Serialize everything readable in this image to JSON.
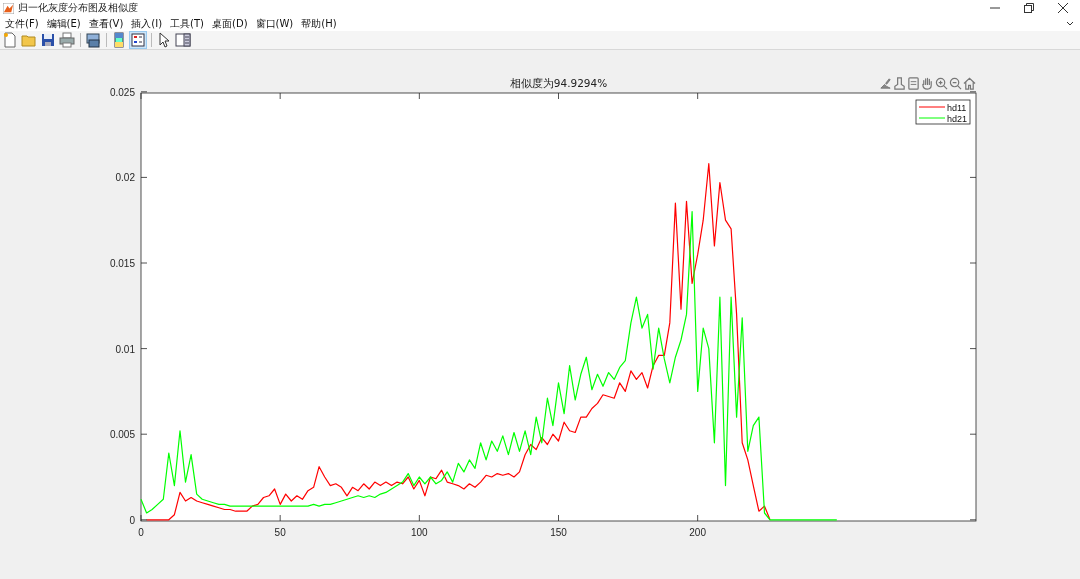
{
  "window": {
    "title": "归一化灰度分布图及相似度"
  },
  "menu": [
    "文件(F)",
    "编辑(E)",
    "查看(V)",
    "插入(I)",
    "工具(T)",
    "桌面(D)",
    "窗口(W)",
    "帮助(H)"
  ],
  "toolbar": [
    {
      "kind": "new",
      "selected": false
    },
    {
      "kind": "open",
      "selected": false
    },
    {
      "kind": "save",
      "selected": false
    },
    {
      "kind": "print",
      "selected": false
    },
    {
      "kind": "link",
      "selected": false
    },
    {
      "kind": "colorbar",
      "selected": false
    },
    {
      "kind": "legend",
      "selected": true
    },
    {
      "kind": "pointer",
      "selected": false
    },
    {
      "kind": "panel",
      "selected": false
    }
  ],
  "axes": {
    "title": "相似度为94.9294%",
    "chart_data": {
      "type": "line",
      "xlim": [
        0,
        300
      ],
      "ylim": [
        0,
        0.025
      ],
      "xticks": [
        0,
        50,
        100,
        150,
        200
      ],
      "yticks": [
        0,
        0.005,
        0.01,
        0.015,
        0.02,
        0.025
      ],
      "legend": "upper right",
      "x": [
        0,
        2,
        4,
        6,
        8,
        10,
        12,
        14,
        16,
        18,
        20,
        22,
        24,
        26,
        28,
        30,
        32,
        34,
        36,
        38,
        40,
        42,
        44,
        46,
        48,
        50,
        52,
        54,
        56,
        58,
        60,
        62,
        64,
        66,
        68,
        70,
        72,
        74,
        76,
        78,
        80,
        82,
        84,
        86,
        88,
        90,
        92,
        94,
        96,
        98,
        100,
        102,
        104,
        106,
        108,
        110,
        112,
        114,
        116,
        118,
        120,
        122,
        124,
        126,
        128,
        130,
        132,
        134,
        136,
        138,
        140,
        142,
        144,
        146,
        148,
        150,
        152,
        154,
        156,
        158,
        160,
        162,
        164,
        166,
        168,
        170,
        172,
        174,
        176,
        178,
        180,
        182,
        184,
        186,
        188,
        190,
        192,
        194,
        196,
        198,
        200,
        202,
        204,
        206,
        208,
        210,
        212,
        214,
        216,
        218,
        220,
        222,
        224,
        226,
        228,
        230,
        232,
        234,
        236,
        238,
        240,
        242,
        244,
        246,
        248,
        250
      ],
      "series": [
        {
          "name": "hd11",
          "color": "#ff0000",
          "values": [
            null,
            0,
            0,
            0,
            0,
            0,
            0.0003,
            0.0016,
            0.0011,
            0.0013,
            0.0011,
            0.001,
            0.0009,
            0.0008,
            0.0007,
            0.0006,
            0.0006,
            0.0005,
            0.0005,
            0.0005,
            0.0008,
            0.0009,
            0.0013,
            0.0014,
            0.0018,
            0.0009,
            0.0015,
            0.0011,
            0.0014,
            0.0012,
            0.0017,
            0.0019,
            0.0031,
            0.0025,
            0.002,
            0.0021,
            0.0019,
            0.0014,
            0.0019,
            0.0017,
            0.0021,
            0.0018,
            0.0022,
            0.002,
            0.0022,
            0.002,
            0.0022,
            0.0021,
            0.0025,
            0.0018,
            0.0023,
            0.0014,
            0.0025,
            0.0024,
            0.0029,
            0.0022,
            0.0021,
            0.002,
            0.0018,
            0.0021,
            0.0019,
            0.0022,
            0.0026,
            0.0025,
            0.0027,
            0.0026,
            0.0027,
            0.0025,
            0.0028,
            0.0038,
            0.0044,
            0.0041,
            0.0048,
            0.0044,
            0.005,
            0.0046,
            0.0057,
            0.0052,
            0.0051,
            0.006,
            0.006,
            0.0065,
            0.0068,
            0.0073,
            0.0072,
            0.0071,
            0.008,
            0.0075,
            0.0087,
            0.0082,
            0.0086,
            0.0077,
            0.009,
            0.0096,
            0.0096,
            0.0115,
            0.0185,
            0.0123,
            0.0186,
            0.0138,
            0.0155,
            0.0175,
            0.0208,
            0.016,
            0.0197,
            0.0175,
            0.017,
            0.012,
            0.0045,
            0.0035,
            0.002,
            0.0005,
            0.0008,
            0,
            null,
            null,
            null,
            null,
            null,
            null,
            null,
            null,
            null,
            null,
            null,
            null
          ]
        },
        {
          "name": "hd21",
          "color": "#00ff00",
          "values": [
            0.0012,
            0.0004,
            0.0006,
            0.0009,
            0.0012,
            0.0039,
            0.002,
            0.0052,
            0.0022,
            0.0038,
            0.0015,
            0.0012,
            0.0011,
            0.001,
            0.0009,
            0.0009,
            0.0008,
            0.0008,
            0.0008,
            0.0008,
            0.0008,
            0.0008,
            0.0008,
            0.0008,
            0.0008,
            0.0008,
            0.0008,
            0.0008,
            0.0008,
            0.0008,
            0.0008,
            0.0009,
            0.0008,
            0.0009,
            0.0009,
            0.001,
            0.0011,
            0.0012,
            0.0013,
            0.0014,
            0.0013,
            0.0014,
            0.0013,
            0.0015,
            0.0016,
            0.0018,
            0.002,
            0.0022,
            0.0027,
            0.002,
            0.0025,
            0.0021,
            0.0025,
            0.0021,
            0.0023,
            0.0028,
            0.0022,
            0.0033,
            0.0028,
            0.0035,
            0.003,
            0.0045,
            0.0035,
            0.0046,
            0.004,
            0.0049,
            0.0038,
            0.0051,
            0.004,
            0.0052,
            0.0038,
            0.006,
            0.0045,
            0.0071,
            0.0055,
            0.008,
            0.0062,
            0.009,
            0.007,
            0.0085,
            0.0095,
            0.0076,
            0.0085,
            0.0078,
            0.0086,
            0.0082,
            0.0089,
            0.0093,
            0.0115,
            0.013,
            0.0112,
            0.012,
            0.0088,
            0.0112,
            0.0094,
            0.008,
            0.0095,
            0.0105,
            0.012,
            0.018,
            0.0075,
            0.0112,
            0.01,
            0.0045,
            0.013,
            0.002,
            0.013,
            0.006,
            0.0118,
            0.004,
            0.0055,
            0.006,
            0.0004,
            0,
            0,
            0,
            0,
            0,
            0,
            0,
            0,
            0,
            0,
            0,
            0,
            0
          ]
        }
      ]
    }
  }
}
